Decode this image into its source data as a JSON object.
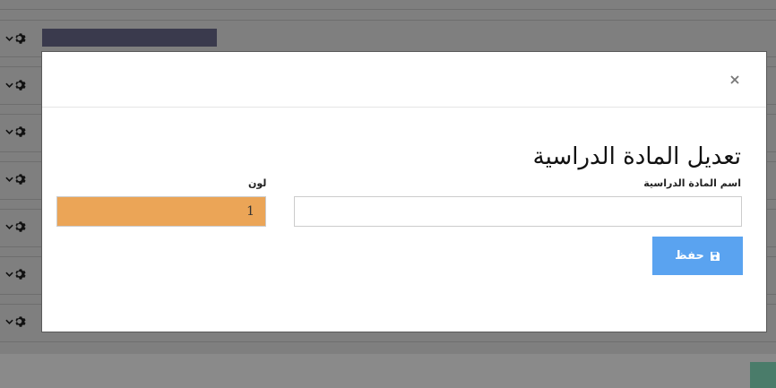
{
  "background": {
    "gear_icon": "gear-icon",
    "chevron_icon": "chevron-down-icon",
    "row_count": 7
  },
  "modal": {
    "close_label": "×",
    "title": "تعديل المادة الدراسية",
    "fields": {
      "subject_name": {
        "label": "اسم المادة الدراسية",
        "value": "",
        "placeholder": ""
      },
      "color": {
        "label": "لون",
        "value": "1",
        "swatch": "#eba557"
      }
    },
    "save_button": {
      "label": "حفظ",
      "icon": "floppy-disk-icon",
      "color": "#5aa3f0"
    }
  }
}
